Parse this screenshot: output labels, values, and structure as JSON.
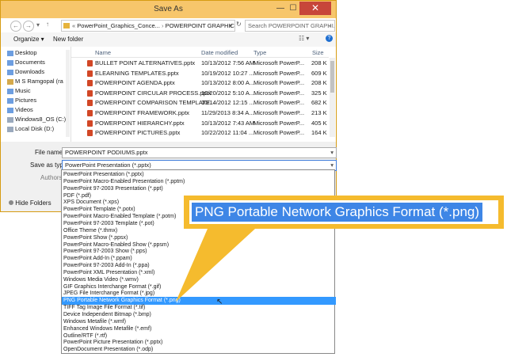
{
  "window": {
    "title": "Save As"
  },
  "address": {
    "path_prefix": "«",
    "path_seg1": "PowerPoint_Graphics_Conce...",
    "separator": "›",
    "path_seg2": "POWERPOINT GRAPHICS",
    "search_placeholder": "Search POWERPOINT GRAPHI..."
  },
  "toolbar": {
    "organize": "Organize ▾",
    "new_folder": "New folder"
  },
  "nav_items": [
    "Desktop",
    "Documents",
    "Downloads",
    "M S Ramgopal (ra",
    "Music",
    "Pictures",
    "Videos",
    "Windows8_OS (C:)",
    "Local Disk (D:)"
  ],
  "columns": {
    "name": "Name",
    "date": "Date modified",
    "type": "Type",
    "size": "Size"
  },
  "files": [
    {
      "name": "BULLET POINT ALTERNATIVES.pptx",
      "date": "10/13/2012 7:56 AM",
      "type": "Microsoft PowerP...",
      "size": "208 K"
    },
    {
      "name": "ELEARNING TEMPLATES.pptx",
      "date": "10/19/2012 10:27 ...",
      "type": "Microsoft PowerP...",
      "size": "609 K"
    },
    {
      "name": "POWERPOINT AGENDA.pptx",
      "date": "10/13/2012 8:00 A...",
      "type": "Microsoft PowerP...",
      "size": "208 K"
    },
    {
      "name": "POWERPOINT CIRCULAR PROCESS.pptx",
      "date": "10/20/2012 5:10 A...",
      "type": "Microsoft PowerP...",
      "size": "325 K"
    },
    {
      "name": "POWERPOINT COMPARISON TEMPLATE...",
      "date": "10/14/2012 12:15 ...",
      "type": "Microsoft PowerP...",
      "size": "682 K"
    },
    {
      "name": "POWERPOINT FRAMEWORK.pptx",
      "date": "11/29/2013 8:34 A...",
      "type": "Microsoft PowerP...",
      "size": "213 K"
    },
    {
      "name": "POWERPOINT HIERARCHY.pptx",
      "date": "10/13/2012 7:43 AM",
      "type": "Microsoft PowerP...",
      "size": "405 K"
    },
    {
      "name": "POWERPOINT PICTURES.pptx",
      "date": "10/22/2012 11:04 ...",
      "type": "Microsoft PowerP...",
      "size": "164 K"
    }
  ],
  "form": {
    "file_name_label": "File name:",
    "file_name_value": "POWERPOINT PODIUMS.pptx",
    "save_type_label": "Save as type:",
    "save_type_value": "PowerPoint Presentation (*.pptx)",
    "authors_label": "Authors:",
    "hide_folders": "Hide Folders"
  },
  "type_options": [
    "PowerPoint Presentation (*.pptx)",
    "PowerPoint Macro-Enabled Presentation (*.pptm)",
    "PowerPoint 97-2003 Presentation (*.ppt)",
    "PDF (*.pdf)",
    "XPS Document (*.xps)",
    "PowerPoint Template (*.potx)",
    "PowerPoint Macro-Enabled Template (*.potm)",
    "PowerPoint 97-2003 Template (*.pot)",
    "Office Theme (*.thmx)",
    "PowerPoint Show (*.ppsx)",
    "PowerPoint Macro-Enabled Show (*.ppsm)",
    "PowerPoint 97-2003 Show (*.pps)",
    "PowerPoint Add-In (*.ppam)",
    "PowerPoint 97-2003 Add-In (*.ppa)",
    "PowerPoint XML Presentation (*.xml)",
    "Windows Media Video (*.wmv)",
    "GIF Graphics Interchange Format (*.gif)",
    "JPEG File Interchange Format (*.jpg)",
    "PNG Portable Network Graphics Format (*.png)",
    "TIFF Tag Image File Format (*.tif)",
    "Device Independent Bitmap (*.bmp)",
    "Windows Metafile (*.wmf)",
    "Enhanced Windows Metafile (*.emf)",
    "Outline/RTF (*.rtf)",
    "PowerPoint Picture Presentation (*.pptx)",
    "OpenDocument Presentation (*.odp)"
  ],
  "selected_option_index": 18,
  "callout": {
    "text": "PNG Portable Network Graphics Format (*.png)"
  },
  "colors": {
    "selection": "#3399ff",
    "callout": "#f5bb2e",
    "titlebar": "#f7c66b"
  }
}
